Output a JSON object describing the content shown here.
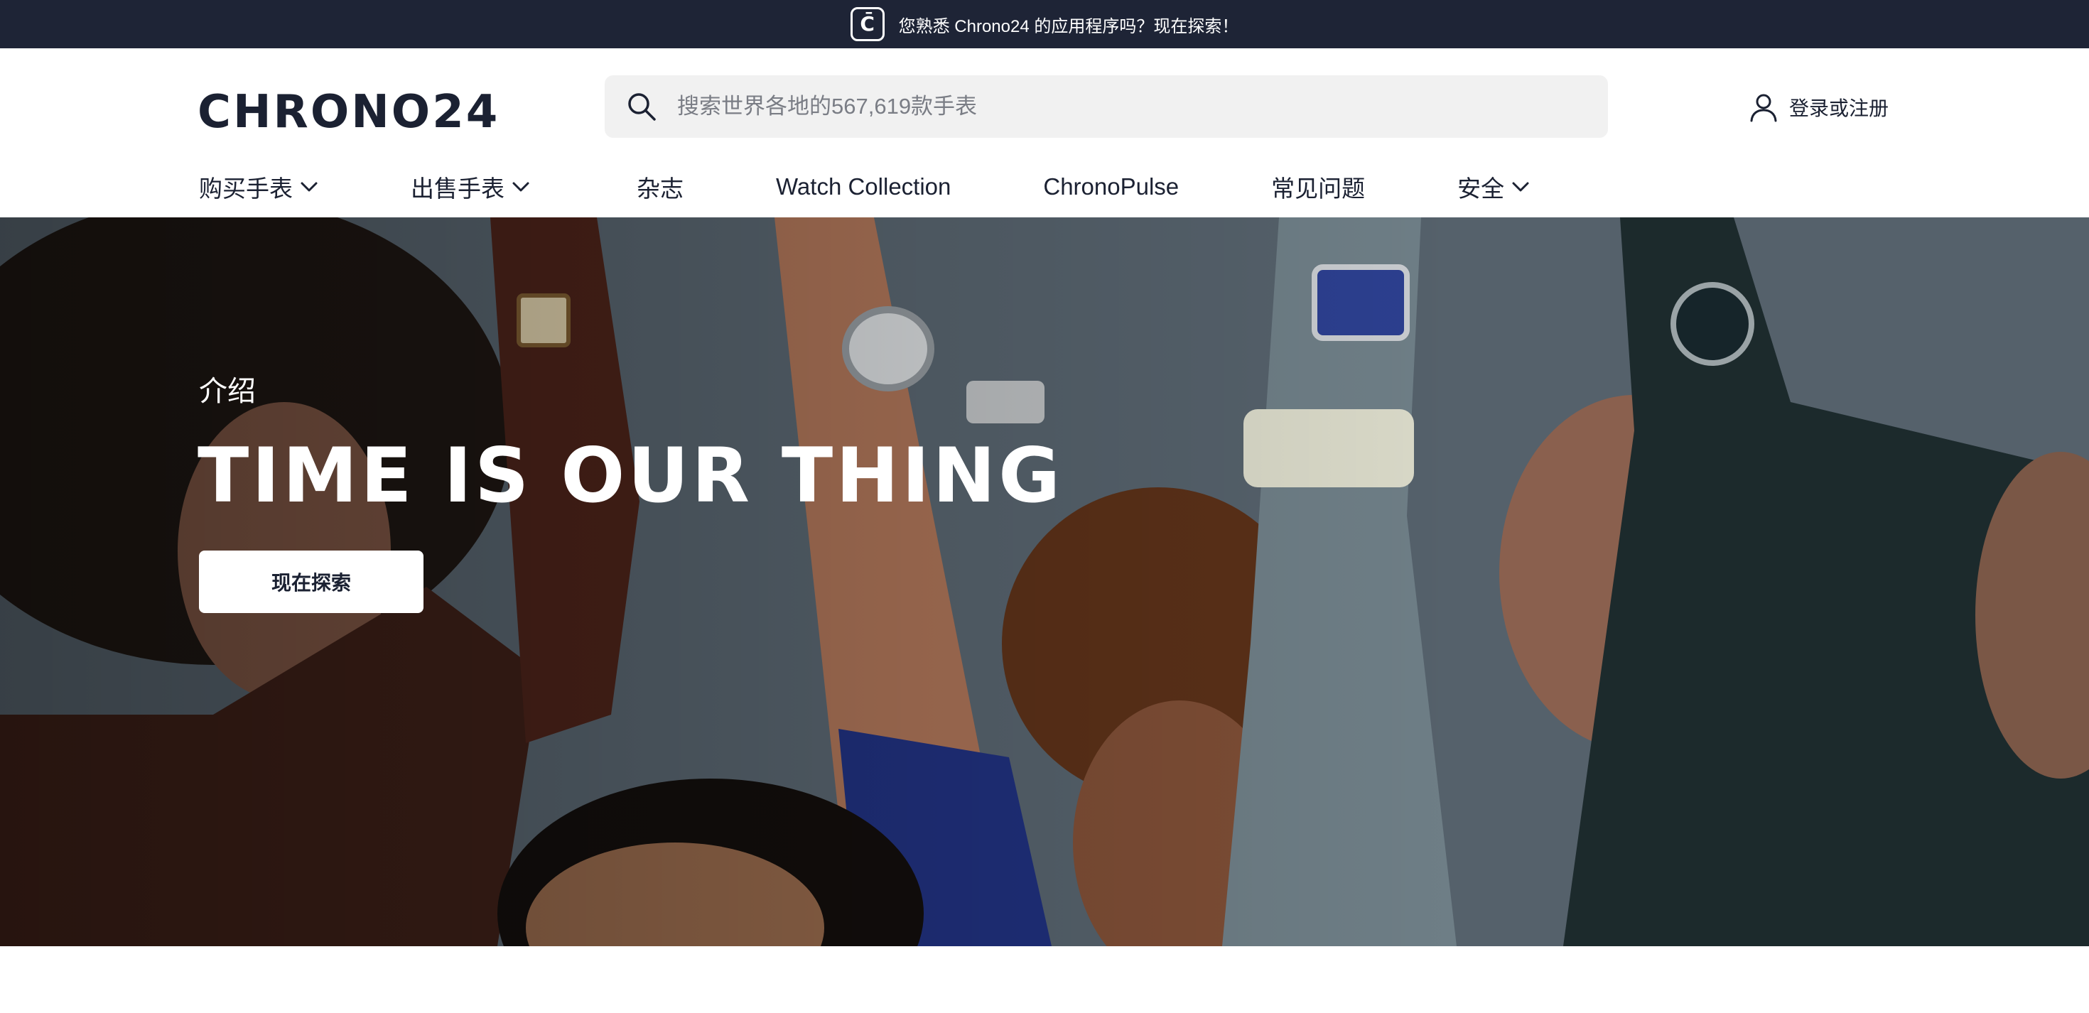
{
  "banner": {
    "text": "您熟悉 Chrono24 的应用程序吗？现在探索！",
    "icon": "chrono24-app-icon",
    "icon_glyph": "C̄",
    "background": "#1e2436"
  },
  "header": {
    "logo_text": "CHRONO24",
    "search": {
      "placeholder": "搜索世界各地的567,619款手表",
      "value": ""
    },
    "login_label": "登录或注册"
  },
  "nav": {
    "items": [
      {
        "label": "购买手表",
        "has_dropdown": true
      },
      {
        "label": "出售手表",
        "has_dropdown": true
      },
      {
        "label": "杂志",
        "has_dropdown": false
      },
      {
        "label": "Watch Collection",
        "has_dropdown": false
      },
      {
        "label": "ChronoPulse",
        "has_dropdown": false
      },
      {
        "label": "常见问题",
        "has_dropdown": false
      },
      {
        "label": "安全",
        "has_dropdown": true
      }
    ]
  },
  "hero": {
    "eyebrow": "介绍",
    "title": "TIME IS OUR THING",
    "cta_label": "现在探索"
  },
  "colors": {
    "brand_dark": "#1b2132",
    "banner_bg": "#1e2436",
    "search_bg": "#f1f1f1",
    "white": "#ffffff"
  }
}
